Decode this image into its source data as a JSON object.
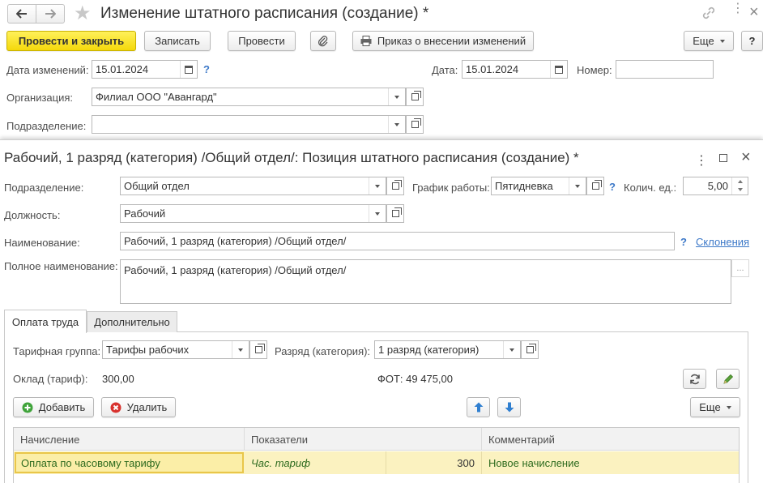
{
  "window": {
    "title": "Изменение штатного расписания (создание) *"
  },
  "toolbar": {
    "post_close": "Провести и закрыть",
    "save": "Записать",
    "post": "Провести",
    "order": "Приказ о внесении изменений",
    "more": "Еще",
    "help": "?"
  },
  "header": {
    "change_date_label": "Дата изменений:",
    "change_date_value": "15.01.2024",
    "date_label": "Дата:",
    "date_value": "15.01.2024",
    "number_label": "Номер:",
    "number_value": "",
    "org_label": "Организация:",
    "org_value": "Филиал ООО \"Авангард\"",
    "dept_label": "Подразделение:",
    "dept_value": ""
  },
  "subform": {
    "title": "Рабочий, 1 разряд (категория) /Общий отдел/: Позиция штатного расписания (создание) *",
    "dept_label": "Подразделение:",
    "dept_value": "Общий отдел",
    "schedule_label": "График работы:",
    "schedule_value": "Пятидневка",
    "qty_label": "Колич. ед.:",
    "qty_value": "5,00",
    "position_label": "Должность:",
    "position_value": "Рабочий",
    "name_label": "Наименование:",
    "name_value": "Рабочий, 1 разряд (категория) /Общий отдел/",
    "declension_link": "Склонения",
    "fullname_label": "Полное наименование:",
    "fullname_value": "Рабочий, 1 разряд (категория) /Общий отдел/",
    "ellipsis": "..."
  },
  "tabs": [
    {
      "label": "Оплата труда"
    },
    {
      "label": "Дополнительно"
    }
  ],
  "pay": {
    "tariff_group_label": "Тарифная группа:",
    "tariff_group_value": "Тарифы рабочих",
    "grade_label": "Разряд (категория):",
    "grade_value": "1 разряд (категория)",
    "salary_label": "Оклад (тариф):",
    "salary_value": "300,00",
    "fot_text": "ФОТ: 49 475,00",
    "add": "Добавить",
    "delete": "Удалить",
    "more": "Еще"
  },
  "table": {
    "columns": [
      "Начисление",
      "Показатели",
      "Комментарий"
    ],
    "rows": [
      {
        "accrual": "Оплата по часовому тарифу",
        "indicator": "Час. тариф",
        "value": "300",
        "comment": "Новое начисление"
      }
    ]
  },
  "colors": {
    "accent_yellow": "#f4d80b",
    "link_blue": "#3c78c8",
    "row_highlight": "#fbf2c0",
    "row_text": "#2e6b1f"
  }
}
